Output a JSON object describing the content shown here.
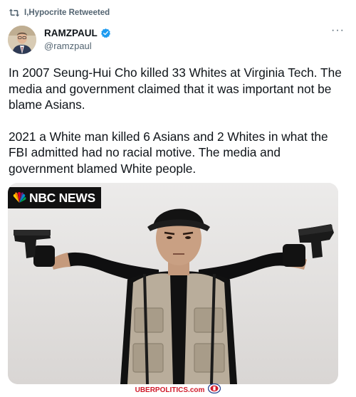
{
  "retweet": {
    "label": "I,Hypocrite Retweeted",
    "icon": "retweet-icon"
  },
  "author": {
    "display_name": "RAMZPAUL",
    "handle": "@ramzpaul",
    "verified": true,
    "verified_color": "#1d9bf0"
  },
  "menu": {
    "icon": "more-options-icon",
    "label": "···"
  },
  "tweet": {
    "paragraphs": [
      "In 2007 Seung-Hui Cho killed 33 Whites at Virginia Tech. The media and government claimed that it was important not be blame Asians.",
      "2021 a White man killed 6 Asians and 2 Whites in what the FBI admitted had no racial motive. The media and government blamed White people."
    ]
  },
  "media": {
    "watermark": "NBC NEWS",
    "logo_icon": "nbc-peacock-icon"
  },
  "footer": {
    "site": "UBERPOLITICS",
    "site_suffix": ".com",
    "badge_icon": "site-badge-icon",
    "accent_color": "#d11a2a"
  },
  "colors": {
    "text": "#0f1419",
    "secondary": "#536471",
    "background": "#ffffff"
  }
}
